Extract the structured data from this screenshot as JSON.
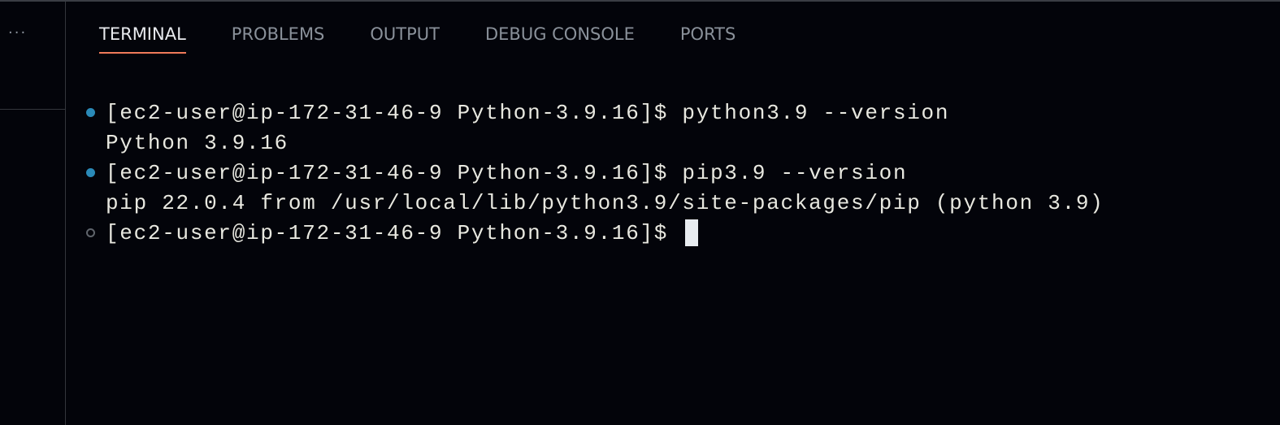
{
  "panel": {
    "more_label": "···"
  },
  "tabs": [
    {
      "label": "TERMINAL",
      "active": true
    },
    {
      "label": "PROBLEMS",
      "active": false
    },
    {
      "label": "OUTPUT",
      "active": false
    },
    {
      "label": "DEBUG CONSOLE",
      "active": false
    },
    {
      "label": "PORTS",
      "active": false
    }
  ],
  "terminal": {
    "lines": [
      {
        "type": "command",
        "status": "success",
        "text": "[ec2-user@ip-172-31-46-9 Python-3.9.16]$ python3.9 --version"
      },
      {
        "type": "output",
        "text": "Python 3.9.16"
      },
      {
        "type": "command",
        "status": "success",
        "text": "[ec2-user@ip-172-31-46-9 Python-3.9.16]$ pip3.9 --version"
      },
      {
        "type": "output",
        "text": "pip 22.0.4 from /usr/local/lib/python3.9/site-packages/pip (python 3.9)"
      },
      {
        "type": "prompt",
        "status": "pending",
        "text": "[ec2-user@ip-172-31-46-9 Python-3.9.16]$ "
      }
    ]
  },
  "colors": {
    "accent": "#f07a5a",
    "success_dot": "#2a8ab8",
    "background": "#03040a"
  }
}
